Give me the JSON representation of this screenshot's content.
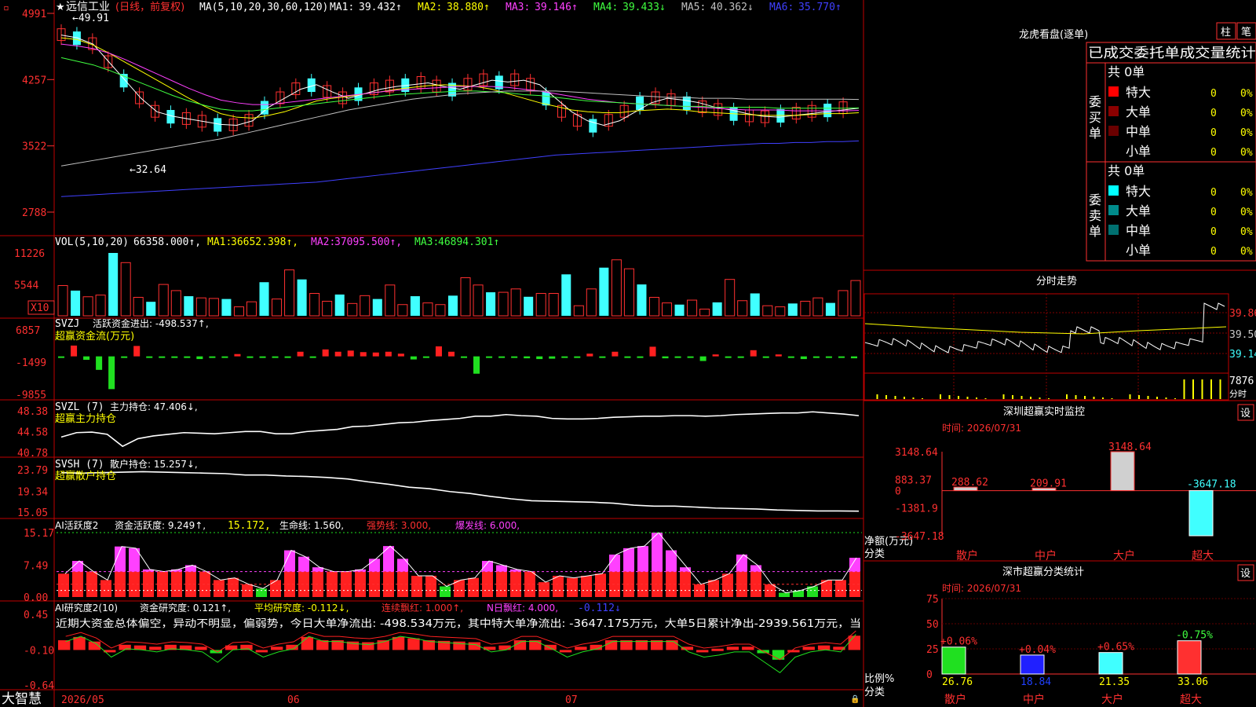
{
  "main": {
    "stock_name": "远信工业",
    "stock_mode": "(日线，前复权)",
    "ma_label": "MA(5,10,20,30,60,120)",
    "ma_values": [
      {
        "label": "MA1:",
        "value": "39.432↑",
        "color": "#ffffff"
      },
      {
        "label": "MA2:",
        "value": "38.880↑",
        "color": "#ffff00"
      },
      {
        "label": "MA3:",
        "value": "39.146↑",
        "color": "#ff40ff"
      },
      {
        "label": "MA4:",
        "value": "39.433↓",
        "color": "#40ff40"
      },
      {
        "label": "MA5:",
        "value": "40.362↓",
        "color": "#c0c0c0"
      },
      {
        "label": "MA6:",
        "value": "35.770↑",
        "color": "#4040ff"
      }
    ],
    "y_ticks": [
      "4991",
      "4257",
      "3522",
      "2788"
    ],
    "high_label": "49.91",
    "low_label": "32.64"
  },
  "vol": {
    "label": "VOL(5,10,20)",
    "value": "66358.000↑,",
    "ma": [
      {
        "label": "MA1:",
        "value": "36652.398↑,",
        "color": "#ffff00"
      },
      {
        "label": "MA2:",
        "value": "37095.500↑,",
        "color": "#ff40ff"
      },
      {
        "label": "MA3:",
        "value": "46894.301↑",
        "color": "#40ff40"
      }
    ],
    "y_ticks": [
      "11226",
      "5544"
    ],
    "unit": "X10"
  },
  "svzj": {
    "label": "SVZJ",
    "title": "活跃资金进出: -498.537↑,",
    "subtitle": "超赢资金流(万元)",
    "y_ticks": [
      "6857",
      "-1499",
      "-9855"
    ]
  },
  "svzl": {
    "label": "SVZL (7)",
    "title": "主力持仓: 47.406↓,",
    "subtitle": "超赢主力持仓",
    "y_ticks": [
      "48.38",
      "44.58",
      "40.78"
    ]
  },
  "svsh": {
    "label": "SVSH (7)",
    "title": "散户持仓: 15.257↓,",
    "subtitle": "超赢散户持仓",
    "y_ticks": [
      "23.79",
      "19.34",
      "15.05"
    ]
  },
  "ai1": {
    "label": "AI活跃度2",
    "title": "资金活跃度: 9.249↑,",
    "v2": "15.172,",
    "life": "生命线: 1.560,",
    "strong": "强势线: 3.000,",
    "burst": "爆发线: 6.000,",
    "y_ticks": [
      "15.17",
      "7.49",
      "0.00"
    ]
  },
  "ai2": {
    "label": "AI研究度2(10)",
    "title": "资金研究度: 0.121↑,",
    "avg": "平均研究度: -0.112↓,",
    "cont": "连续飘红: 1.000↑,",
    "nday": "N日飘红: 4.000,",
    "last": "-0.112↓",
    "comment": "近期大资金总体偏空，异动不明显，偏弱势，今日大单净流出: -498.534万元，其中特大单净流出: -3647.175万元，大单5日累计净出-2939.561万元，当",
    "y_ticks": [
      "0.45",
      "-0.10",
      "-0.64"
    ]
  },
  "footer": {
    "brand": "大智慧",
    "dates": [
      "2026/05",
      "06",
      "07"
    ]
  },
  "dragon": {
    "title": "龙虎看盘(逐单)",
    "btn_zhu": "柱",
    "btn_bi": "笔",
    "header": "已成交委托单成交量统计",
    "buy_side": "委买单",
    "sell_side": "委卖单",
    "buy_total": "共 0单",
    "sell_total": "共 0单",
    "buy_rows": [
      {
        "name": "特大",
        "count": "0",
        "pct": "0%",
        "color": "#ff0000"
      },
      {
        "name": "大单",
        "count": "0",
        "pct": "0%",
        "color": "#8b0000"
      },
      {
        "name": "中单",
        "count": "0",
        "pct": "0%",
        "color": "#6a0000"
      },
      {
        "name": "小单",
        "count": "0",
        "pct": "0%",
        "color": "#000000"
      }
    ],
    "sell_rows": [
      {
        "name": "特大",
        "count": "0",
        "pct": "0%",
        "color": "#00ffff"
      },
      {
        "name": "大单",
        "count": "0",
        "pct": "0%",
        "color": "#008b8b"
      },
      {
        "name": "中单",
        "count": "0",
        "pct": "0%",
        "color": "#007070"
      },
      {
        "name": "小单",
        "count": "0",
        "pct": "0%",
        "color": "#000000"
      }
    ]
  },
  "intraday": {
    "title": "分时走势",
    "prices": [
      "39.86",
      "39.50",
      "39.14"
    ],
    "vol": "7876",
    "vol_label": "分时"
  },
  "monitor": {
    "title": "深圳超赢实时监控",
    "set": "设",
    "time": "时间: 2026/07/31",
    "y_ticks": [
      "3148.64",
      "883.37",
      "0",
      "-1381.9",
      "-3647.18"
    ],
    "axis_label": "净额(万元)",
    "cat_label": "分类"
  },
  "stats": {
    "title": "深市超赢分类统计",
    "set": "设",
    "time": "时间: 2026/07/31",
    "y_ticks": [
      "75",
      "50",
      "25",
      "0"
    ],
    "axis_label": "比例%",
    "cat_label": "分类"
  },
  "chart_data": [
    {
      "type": "line",
      "title": "远信工业(日线，前复权)",
      "ylim": [
        27.88,
        49.91
      ],
      "series": [
        {
          "name": "MA1",
          "values": [
            47.5,
            47.2,
            46.5,
            44.5,
            42.5,
            40.5,
            39.0,
            38.5,
            38.2,
            37.9,
            37.6,
            37.5,
            38.0,
            39.5,
            40.5,
            41.5,
            42.0,
            41.2,
            40.5,
            41.0,
            41.5,
            41.8,
            42.0,
            42.2,
            41.8,
            41.5,
            42.0,
            42.5,
            42.3,
            42.5,
            42.0,
            40.5,
            39.0,
            38.0,
            37.5,
            38.0,
            39.0,
            40.0,
            40.5,
            40.3,
            40.0,
            39.5,
            39.2,
            38.8,
            38.5,
            38.4,
            38.6,
            38.8,
            39.0,
            39.2,
            39.4
          ]
        },
        {
          "name": "MA2",
          "values": [
            47.2,
            47.0,
            46.4,
            45.5,
            44.5,
            43.5,
            42.5,
            41.5,
            40.5,
            39.6,
            38.8,
            38.4,
            38.3,
            38.6,
            39.0,
            39.6,
            40.2,
            40.5,
            40.7,
            41.0,
            41.2,
            41.5,
            41.7,
            41.9,
            42.0,
            41.9,
            41.8,
            41.5,
            41.0,
            40.5,
            40.0,
            39.6,
            39.2,
            39.0,
            38.9,
            38.9,
            39.1,
            39.2,
            39.3,
            39.2,
            39.0,
            38.9,
            38.8,
            38.7,
            38.6,
            38.6,
            38.6,
            38.7,
            38.8,
            38.8,
            38.9
          ]
        },
        {
          "name": "MA3",
          "values": [
            46.5,
            46.3,
            46.0,
            45.5,
            44.8,
            44.0,
            43.2,
            42.4,
            41.6,
            40.9,
            40.3,
            40.0,
            39.8,
            39.8,
            40.0,
            40.2,
            40.4,
            40.6,
            40.8,
            41.0,
            41.2,
            41.4,
            41.5,
            41.6,
            41.7,
            41.8,
            41.8,
            41.8,
            41.7,
            41.5,
            41.3,
            41.0,
            40.7,
            40.4,
            40.2,
            40.0,
            39.9,
            39.8,
            39.7,
            39.6,
            39.5,
            39.4,
            39.3,
            39.2,
            39.2,
            39.2,
            39.1,
            39.1,
            39.1,
            39.1,
            39.15
          ]
        },
        {
          "name": "MA4",
          "values": [
            45.0,
            44.6,
            44.2,
            43.6,
            42.9,
            42.2,
            41.5,
            40.8,
            40.2,
            39.7,
            39.3,
            39.1,
            39.1,
            39.3,
            39.5,
            39.7,
            39.9,
            40.1,
            40.3,
            40.5,
            40.7,
            40.9,
            41.0,
            41.1,
            41.2,
            41.3,
            41.3,
            41.2,
            41.1,
            40.9,
            40.8,
            40.6,
            40.4,
            40.2,
            40.1,
            40.0,
            39.9,
            39.8,
            39.7,
            39.6,
            39.6,
            39.5,
            39.5,
            39.5,
            39.5,
            39.4,
            39.4,
            39.4,
            39.4,
            39.4,
            39.43
          ]
        },
        {
          "name": "MA5",
          "values": [
            33.0,
            33.3,
            33.6,
            33.9,
            34.2,
            34.5,
            34.8,
            35.1,
            35.4,
            35.7,
            36.0,
            36.4,
            36.8,
            37.2,
            37.6,
            38.0,
            38.4,
            38.8,
            39.2,
            39.5,
            39.8,
            40.1,
            40.4,
            40.6,
            40.8,
            41.0,
            41.1,
            41.2,
            41.3,
            41.3,
            41.3,
            41.3,
            41.2,
            41.1,
            41.0,
            40.9,
            40.8,
            40.7,
            40.6,
            40.6,
            40.5,
            40.5,
            40.5,
            40.4,
            40.4,
            40.4,
            40.4,
            40.4,
            40.4,
            40.4,
            40.36
          ]
        },
        {
          "name": "MA6",
          "values": [
            29.6,
            29.7,
            29.8,
            29.9,
            30.0,
            30.1,
            30.2,
            30.3,
            30.4,
            30.5,
            30.6,
            30.7,
            30.8,
            30.9,
            31.0,
            31.1,
            31.2,
            31.4,
            31.6,
            31.8,
            32.0,
            32.2,
            32.4,
            32.6,
            32.8,
            33.0,
            33.2,
            33.4,
            33.6,
            33.8,
            34.0,
            34.2,
            34.3,
            34.4,
            34.5,
            34.6,
            34.7,
            34.8,
            34.9,
            35.0,
            35.1,
            35.2,
            35.3,
            35.4,
            35.5,
            35.5,
            35.6,
            35.6,
            35.7,
            35.7,
            35.77
          ]
        }
      ]
    },
    {
      "type": "bar",
      "title": "VOL(5,10,20)",
      "values": [
        5400,
        4500,
        3400,
        3700,
        11226,
        9500,
        3300,
        2500,
        5600,
        4500,
        3500,
        3200,
        3100,
        3000,
        1600,
        2500,
        6000,
        3000,
        8200,
        6500,
        4000,
        2600,
        3800,
        2200,
        3600,
        3000,
        5500,
        2000,
        3500,
        2300,
        2000,
        3600,
        6800,
        5500,
        4200,
        4200,
        4800,
        3400,
        4000,
        4000,
        7400,
        1800,
        4800,
        8600,
        10000,
        8400,
        5600,
        3300,
        2300,
        2000,
        2800,
        1200,
        2400,
        6500,
        2700,
        4000,
        1800,
        1600,
        2200,
        2600,
        3200,
        2300,
        4500,
        6300
      ]
    },
    {
      "type": "bar",
      "title": "SVZJ 活跃资金进出",
      "values": [
        -300,
        2800,
        -900,
        -3500,
        -8500,
        -400,
        2700,
        -300,
        -300,
        -250,
        -300,
        -700,
        -400,
        -300,
        600,
        -300,
        -300,
        -200,
        -300,
        1200,
        -300,
        1800,
        1200,
        1500,
        1100,
        1000,
        1200,
        700,
        -800,
        -300,
        2600,
        1200,
        -200,
        -4500,
        -300,
        -200,
        -300,
        -500,
        -700,
        -600,
        -300,
        -300,
        700,
        -200,
        1200,
        -300,
        -300,
        2500,
        -500,
        -300,
        -200,
        -1200,
        500,
        -300,
        -200,
        1600,
        -200,
        500,
        -300,
        -700,
        -300,
        -200,
        -300,
        -500
      ]
    },
    {
      "type": "line",
      "title": "SVZL 主力持仓",
      "ylim": [
        40.78,
        48.38
      ],
      "values": [
        43.6,
        44.4,
        44.5,
        44.1,
        41.9,
        43.3,
        43.8,
        44.1,
        44.4,
        44.3,
        44.2,
        44.4,
        44.6,
        44.6,
        44.2,
        44.2,
        44.6,
        44.8,
        45.0,
        45.5,
        45.6,
        45.9,
        46.2,
        46.3,
        46.6,
        46.8,
        47.0,
        47.4,
        47.4,
        47.7,
        47.5,
        47.4,
        47.0,
        46.9,
        46.9,
        47.0,
        47.2,
        47.3,
        47.4,
        47.4,
        47.5,
        47.5,
        47.4,
        47.5,
        47.7,
        47.8,
        47.9,
        48.0,
        48.0,
        48.2,
        48.0,
        47.8,
        47.5
      ]
    },
    {
      "type": "line",
      "title": "SVSH 散户持仓",
      "ylim": [
        15.05,
        23.79
      ],
      "values": [
        23.2,
        23.1,
        23.2,
        23.3,
        23.4,
        23.3,
        23.2,
        23.1,
        23.0,
        22.7,
        22.7,
        22.5,
        22.4,
        22.2,
        21.9,
        21.3,
        20.8,
        20.2,
        19.9,
        19.3,
        18.9,
        18.3,
        17.8,
        17.4,
        17.3,
        17.2,
        17.1,
        16.9,
        16.5,
        16.3,
        16.3,
        16.1,
        15.9,
        15.8,
        15.7,
        15.5,
        15.4,
        15.3,
        15.3,
        15.26
      ]
    },
    {
      "type": "bar",
      "title": "AI活跃度2",
      "ylim": [
        0,
        15.17
      ],
      "values": [
        5.5,
        8.5,
        6.0,
        4.0,
        11.9,
        11.5,
        6.5,
        6.0,
        6.5,
        7.5,
        6.0,
        4.0,
        4.5,
        3.0,
        2.0,
        4.0,
        11.0,
        9.5,
        7.0,
        6.0,
        6.0,
        6.5,
        9.0,
        12.0,
        9.0,
        5.0,
        5.0,
        2.5,
        4.0,
        4.5,
        8.5,
        7.5,
        6.5,
        6.0,
        3.5,
        5.0,
        4.5,
        5.0,
        5.5,
        10.0,
        11.5,
        12.0,
        15.17,
        11.0,
        7.0,
        3.0,
        4.0,
        5.5,
        10.0,
        7.5,
        3.0,
        1.0,
        1.5,
        2.5,
        4.0,
        4.0,
        9.25
      ]
    },
    {
      "type": "bar",
      "title": "AI研究度2",
      "ylim": [
        -0.64,
        0.45
      ],
      "values": [
        0.05,
        0.1,
        0.03,
        -0.1,
        -0.02,
        -0.03,
        -0.05,
        -0.02,
        -0.03,
        -0.05,
        -0.15,
        -0.03,
        -0.02,
        -0.1,
        -0.05,
        -0.02,
        0.1,
        0.05,
        0.05,
        0.03,
        0.02,
        0.05,
        0.1,
        0.08,
        0.05,
        0.04,
        0.03,
        0.02,
        -0.05,
        -0.03,
        0.05,
        0.05,
        -0.02,
        -0.1,
        -0.05,
        -0.02,
        0.05,
        0.05,
        0.05,
        0.05,
        0.05,
        -0.05,
        -0.1,
        -0.08,
        -0.05,
        -0.05,
        -0.15,
        -0.25,
        -0.1,
        -0.05,
        -0.03,
        -0.05,
        0.12
      ]
    },
    {
      "type": "bar",
      "title": "深圳超赢实时监控",
      "categories": [
        "散户",
        "中户",
        "大户",
        "超大"
      ],
      "values": [
        288.62,
        209.91,
        3148.64,
        -3647.18
      ],
      "ylim": [
        -3647.18,
        3148.64
      ]
    },
    {
      "type": "bar",
      "title": "深市超赢分类统计",
      "categories": [
        "散户",
        "中户",
        "大户",
        "超大"
      ],
      "values": [
        26.76,
        18.84,
        21.35,
        33.06
      ],
      "changes": [
        "+0.06%",
        "+0.04%",
        "+0.65%",
        "-0.75%"
      ],
      "ylim": [
        0,
        75
      ]
    }
  ]
}
